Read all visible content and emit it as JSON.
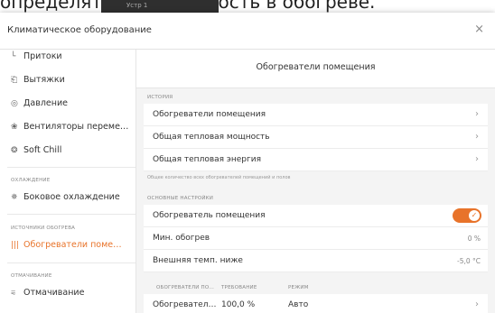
{
  "background": {
    "text": "определяться потребность в обогреве.",
    "strip_text": "Устр 1"
  },
  "dialog": {
    "title": "Климатическое оборудование",
    "close": "×"
  },
  "sidebar": {
    "items": [
      {
        "icon": "└",
        "label": "Притоки"
      },
      {
        "icon": "⎗",
        "label": "Вытяжки"
      },
      {
        "icon": "◎",
        "label": "Давление"
      },
      {
        "icon": "❀",
        "label": "Вентиляторы переме…"
      },
      {
        "icon": "❂",
        "label": "Soft Chill"
      }
    ],
    "sections": [
      {
        "title": "ОХЛАЖДЕНИЕ",
        "items": [
          {
            "icon": "✵",
            "label": "Боковое охлаждение"
          }
        ]
      },
      {
        "title": "ИСТОЧНИКИ ОБОГРЕВА",
        "items": [
          {
            "icon": "|||",
            "label": "Обогреватели поме…"
          }
        ]
      },
      {
        "title": "ОТМАЧИВАНИЕ",
        "items": [
          {
            "icon": "⩳",
            "label": "Отмачивание"
          }
        ]
      }
    ]
  },
  "main": {
    "title": "Обогреватели помещения",
    "history": {
      "title": "ИСТОРИЯ",
      "rows": [
        {
          "label": "Обогреватели помещения"
        },
        {
          "label": "Общая тепловая мощность"
        },
        {
          "label": "Общая тепловая энергия"
        }
      ],
      "note": "Общее количество всех обогревателей помещений и полов"
    },
    "settings": {
      "title": "ОСНОВНЫЕ НАСТРОЙКИ",
      "toggle_label": "Обогреватель помещения",
      "toggle_on": true,
      "rows": [
        {
          "label": "Мин. обогрев",
          "value": "0 %"
        },
        {
          "label": "Внешняя темп. ниже",
          "value": "-5,0 °C"
        }
      ]
    },
    "table": {
      "headers": [
        "ОБОГРЕВАТЕЛИ ПО…",
        "ТРЕБОВАНИЕ",
        "РЕЖИМ"
      ],
      "rows": [
        {
          "name": "Обогревател…",
          "demand": "100,0 %",
          "mode": "Авто"
        }
      ]
    }
  },
  "colors": {
    "accent": "#e8732a"
  }
}
